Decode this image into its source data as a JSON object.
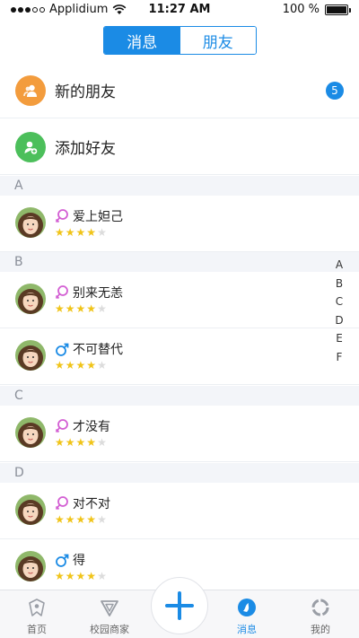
{
  "status_bar": {
    "carrier": "Applidium",
    "time": "11:27 AM",
    "battery": "100 %",
    "battery_level": 1.0
  },
  "segmented": {
    "tabs": [
      {
        "label": "消息",
        "active": true
      },
      {
        "label": "朋友",
        "active": false
      }
    ]
  },
  "actions": {
    "new_friends": {
      "label": "新的朋友",
      "badge": "5",
      "icon": "new-friends-icon",
      "color": "#f39c3d"
    },
    "add_friend": {
      "label": "添加好友",
      "icon": "add-friend-icon",
      "color": "#4cbf5b"
    }
  },
  "sections": [
    {
      "letter": "A",
      "contacts": [
        {
          "name": "爱上妲己",
          "gender": "female",
          "rating": 4
        }
      ]
    },
    {
      "letter": "B",
      "contacts": [
        {
          "name": "别来无恙",
          "gender": "female",
          "rating": 4
        },
        {
          "name": "不可替代",
          "gender": "male",
          "rating": 4
        }
      ]
    },
    {
      "letter": "C",
      "contacts": [
        {
          "name": "才没有",
          "gender": "female",
          "rating": 4
        }
      ]
    },
    {
      "letter": "D",
      "contacts": [
        {
          "name": "对不对",
          "gender": "female",
          "rating": 4
        },
        {
          "name": "得",
          "gender": "male",
          "rating": 4
        }
      ]
    }
  ],
  "index_bar": [
    "A",
    "B",
    "C",
    "D",
    "E",
    "F"
  ],
  "tab_bar": {
    "tabs": [
      {
        "label": "首页",
        "icon": "home-icon",
        "active": false
      },
      {
        "label": "校园商家",
        "icon": "campus-shop-icon",
        "active": false
      },
      {
        "label": "消息",
        "icon": "message-icon",
        "active": true
      },
      {
        "label": "我的",
        "icon": "profile-icon",
        "active": false
      }
    ],
    "fab_icon": "plus-icon"
  },
  "colors": {
    "accent": "#1b8be5",
    "female": "#d35fd3",
    "male": "#1b8be5",
    "star": "#f0c419"
  }
}
